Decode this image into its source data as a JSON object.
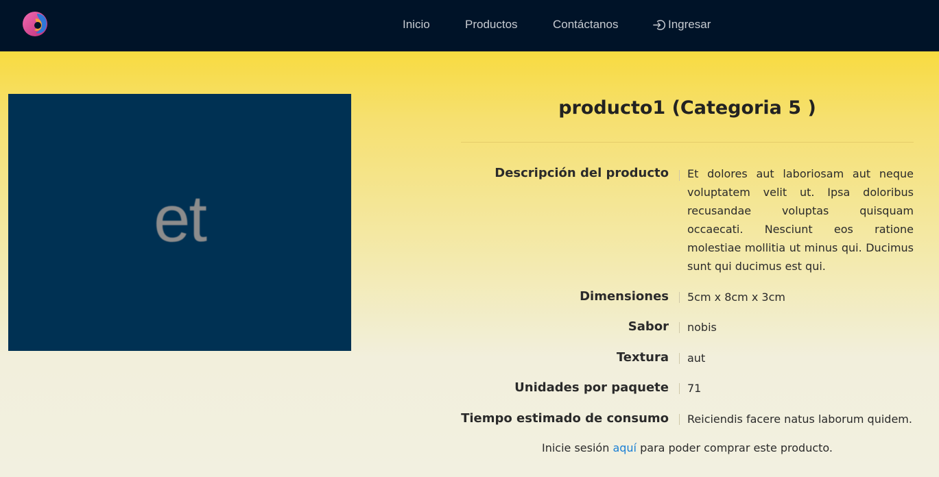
{
  "navbar": {
    "logo_icon": "logo-swirl-icon",
    "links": [
      {
        "label": "Inicio"
      },
      {
        "label": "Productos"
      },
      {
        "label": "Contáctanos"
      },
      {
        "label": "Ingresar",
        "icon": "sign-in-icon"
      }
    ]
  },
  "product": {
    "image_text": "et",
    "image_bg": "#003153",
    "title": "producto1 (Categoria 5 )",
    "details": [
      {
        "label": "Descripción del producto",
        "value": "Et dolores aut laboriosam aut neque voluptatem velit ut. Ipsa doloribus recusandae voluptas quisquam occaecati. Nesciunt eos ratione molestiae mollitia ut minus qui. Ducimus sunt qui ducimus est qui."
      },
      {
        "label": "Dimensiones",
        "value": "5cm x 8cm x 3cm"
      },
      {
        "label": "Sabor",
        "value": "nobis"
      },
      {
        "label": "Textura",
        "value": "aut"
      },
      {
        "label": "Unidades por paquete",
        "value": "71"
      },
      {
        "label": "Tiempo estimado de consumo",
        "value": "Reiciendis facere natus laborum quidem."
      }
    ]
  },
  "login_note": {
    "prefix": "Inicie sesión",
    "link": "aquí",
    "suffix": "para poder comprar este producto."
  },
  "colors": {
    "navbar_bg": "#001328",
    "link_accent": "#1a7fd4"
  }
}
